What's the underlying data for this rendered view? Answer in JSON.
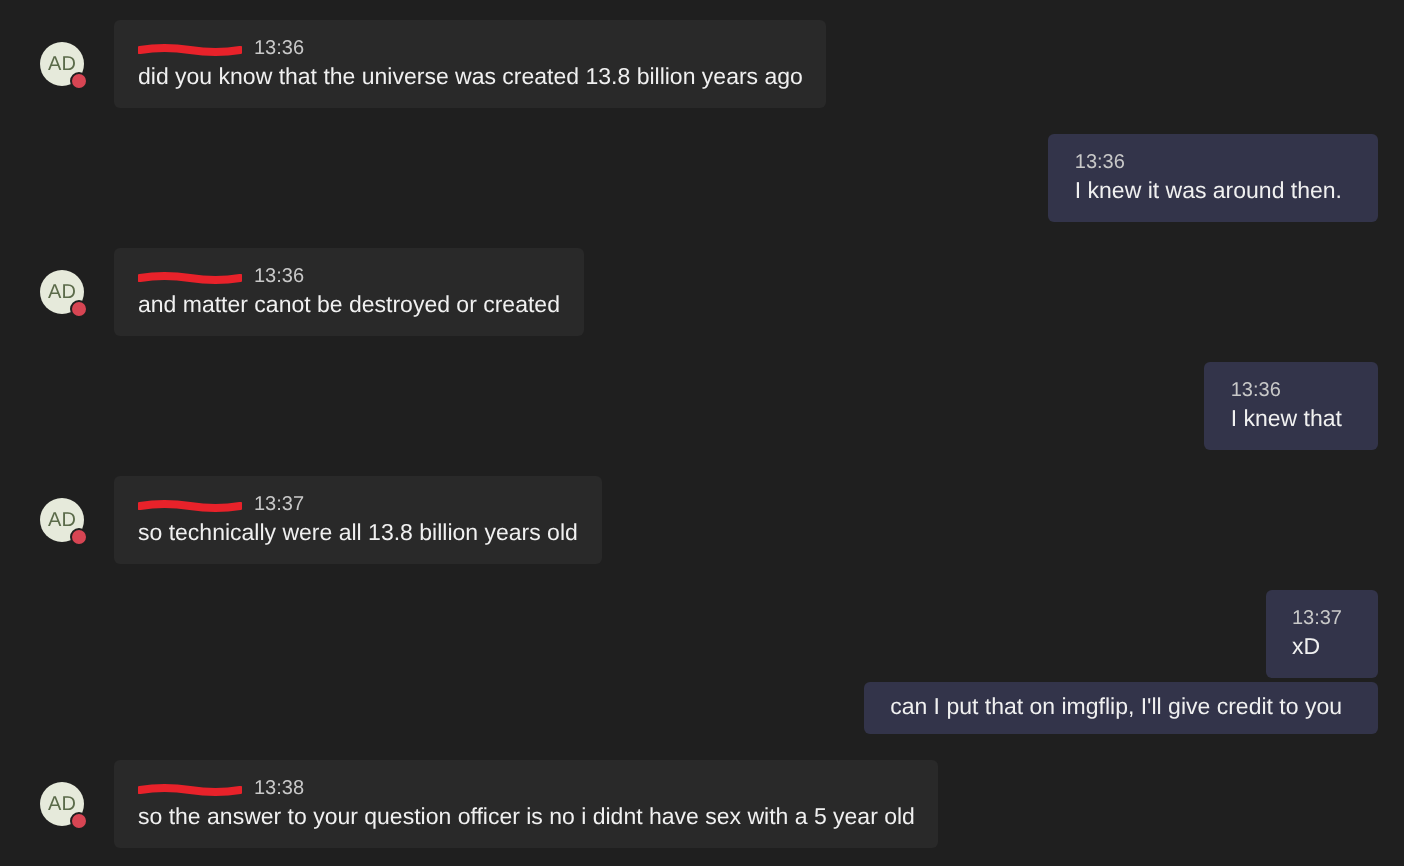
{
  "messages": [
    {
      "kind": "incoming",
      "avatar": "AD",
      "busy": true,
      "time": "13:36",
      "text": "did you know that the universe was created 13.8 billion years ago"
    },
    {
      "kind": "outgoing",
      "time": "13:36",
      "text": "I knew it was around then."
    },
    {
      "kind": "incoming",
      "avatar": "AD",
      "busy": true,
      "time": "13:36",
      "text": "and matter canot be destroyed or created"
    },
    {
      "kind": "outgoing",
      "time": "13:36",
      "text": "I knew that"
    },
    {
      "kind": "incoming",
      "avatar": "AD",
      "busy": true,
      "time": "13:37",
      "text": "so technically were all 13.8 billion years old"
    },
    {
      "kind": "outgoing",
      "time": "13:37",
      "text": "xD"
    },
    {
      "kind": "continuation",
      "text": "can I put that on imgflip, I'll give credit to you"
    },
    {
      "kind": "incoming",
      "avatar": "AD",
      "busy": true,
      "time": "13:38",
      "text": "so the answer to your question officer is no i didnt have sex with a 5 year old"
    }
  ]
}
